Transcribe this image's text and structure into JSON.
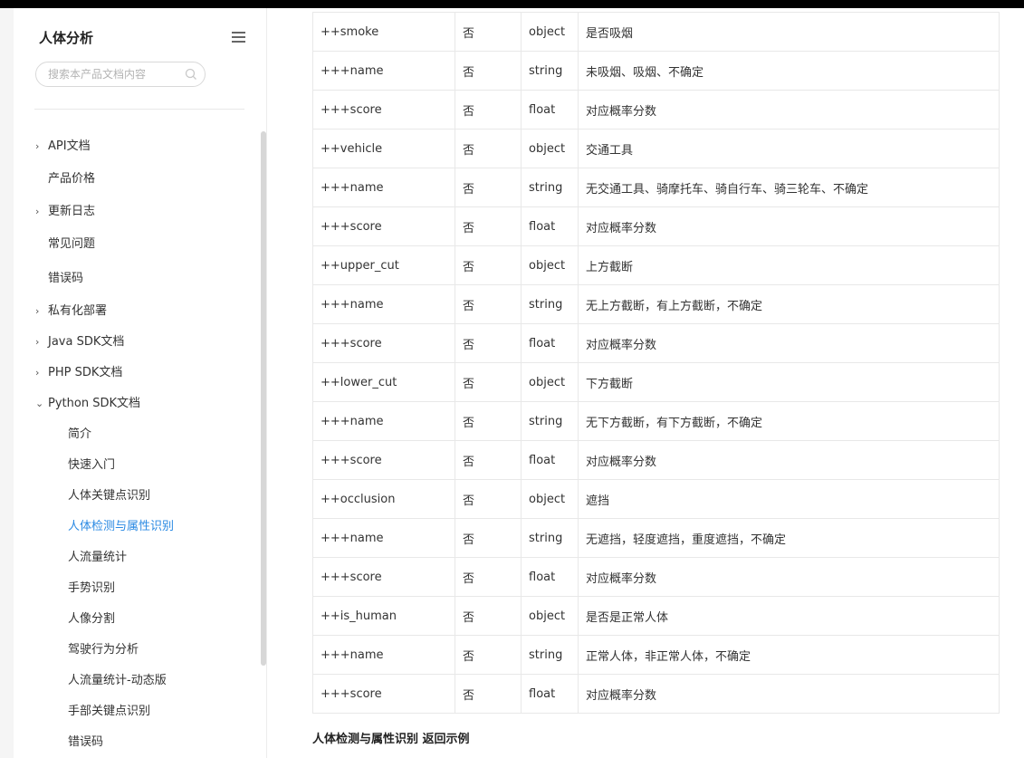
{
  "sidebar": {
    "title": "人体分析",
    "search_placeholder": "搜索本产品文档内容",
    "items": [
      {
        "label": "API文档",
        "chevron": "›"
      },
      {
        "label": "产品价格",
        "chevron": ""
      },
      {
        "label": "更新日志",
        "chevron": "›"
      },
      {
        "label": "常见问题",
        "chevron": ""
      },
      {
        "label": "错误码",
        "chevron": ""
      },
      {
        "label": "私有化部署",
        "chevron": "›"
      },
      {
        "label": "Java SDK文档",
        "chevron": "›"
      },
      {
        "label": "PHP SDK文档",
        "chevron": "›"
      },
      {
        "label": "Python SDK文档",
        "chevron": "⌄"
      }
    ],
    "subitems": [
      {
        "label": "简介"
      },
      {
        "label": "快速入门"
      },
      {
        "label": "人体关键点识别"
      },
      {
        "label": "人体检测与属性识别",
        "active": true
      },
      {
        "label": "人流量统计"
      },
      {
        "label": "手势识别"
      },
      {
        "label": "人像分割"
      },
      {
        "label": "驾驶行为分析"
      },
      {
        "label": "人流量统计-动态版"
      },
      {
        "label": "手部关键点识别"
      },
      {
        "label": "错误码"
      }
    ]
  },
  "table": {
    "rows": [
      [
        "++smoke",
        "否",
        "object",
        "是否吸烟"
      ],
      [
        "+++name",
        "否",
        "string",
        "未吸烟、吸烟、不确定"
      ],
      [
        "+++score",
        "否",
        "float",
        "对应概率分数"
      ],
      [
        "++vehicle",
        "否",
        "object",
        "交通工具"
      ],
      [
        "+++name",
        "否",
        "string",
        "无交通工具、骑摩托车、骑自行车、骑三轮车、不确定"
      ],
      [
        "+++score",
        "否",
        "float",
        "对应概率分数"
      ],
      [
        "++upper_cut",
        "否",
        "object",
        "上方截断"
      ],
      [
        "+++name",
        "否",
        "string",
        "无上方截断，有上方截断，不确定"
      ],
      [
        "+++score",
        "否",
        "float",
        "对应概率分数"
      ],
      [
        "++lower_cut",
        "否",
        "object",
        "下方截断"
      ],
      [
        "+++name",
        "否",
        "string",
        "无下方截断，有下方截断，不确定"
      ],
      [
        "+++score",
        "否",
        "float",
        "对应概率分数"
      ],
      [
        "++occlusion",
        "否",
        "object",
        "遮挡"
      ],
      [
        "+++name",
        "否",
        "string",
        "无遮挡，轻度遮挡，重度遮挡，不确定"
      ],
      [
        "+++score",
        "否",
        "float",
        "对应概率分数"
      ],
      [
        "++is_human",
        "否",
        "object",
        "是否是正常人体"
      ],
      [
        "+++name",
        "否",
        "string",
        "正常人体，非正常人体，不确定"
      ],
      [
        "+++score",
        "否",
        "float",
        "对应概率分数"
      ]
    ]
  },
  "section": {
    "title": "人体检测与属性识别 返回示例"
  },
  "icons": {
    "menu": "hamburger-icon",
    "search": "search-icon",
    "chevron_right": "chevron-right-icon",
    "chevron_down": "chevron-down-icon"
  },
  "colors": {
    "active": "#2b8ae3",
    "border": "#e8e8e8"
  }
}
